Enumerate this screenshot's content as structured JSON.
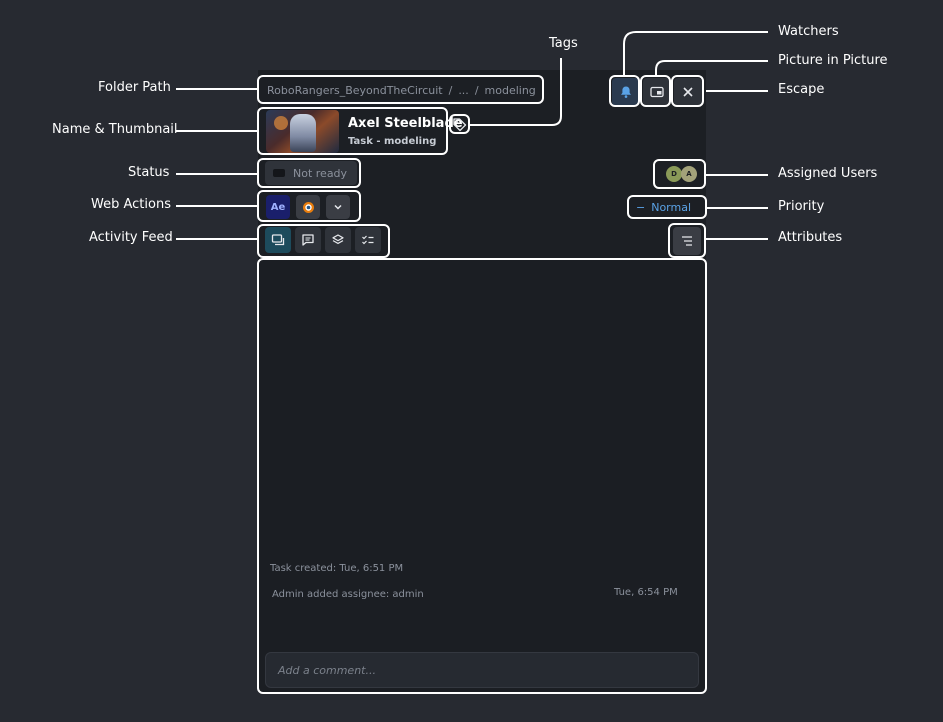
{
  "annotations": {
    "folder_path": "Folder Path",
    "name_thumbnail": "Name & Thumbnail",
    "status": "Status",
    "web_actions": "Web Actions",
    "activity_feed": "Activity Feed",
    "tags": "Tags",
    "watchers": "Watchers",
    "picture_in_picture": "Picture in Picture",
    "escape": "Escape",
    "assigned_users": "Assigned Users",
    "priority": "Priority",
    "attributes": "Attributes"
  },
  "breadcrumb": {
    "project": "RoboRangers_BeyondTheCircuit",
    "sep1": "/",
    "ellipsis": "...",
    "sep2": "/",
    "folder": "modeling"
  },
  "entity": {
    "name": "Axel Steelblade",
    "subtitle": "Task - modeling"
  },
  "status": {
    "label": "Not ready"
  },
  "assignees": [
    {
      "initial": "D",
      "color": "#8a9a58"
    },
    {
      "initial": "A",
      "color": "#a3a27a"
    }
  ],
  "web_actions": [
    {
      "label": "Ae",
      "icon": "after-effects-icon"
    },
    {
      "label": "",
      "icon": "blender-icon"
    }
  ],
  "priority": {
    "icon": "−",
    "label": "Normal"
  },
  "feed": {
    "task_created": "Task created: Tue, 6:51 PM",
    "assignee_event": "Admin added assignee: admin",
    "assignee_time": "Tue, 6:54 PM"
  },
  "comment": {
    "placeholder": "Add a comment..."
  },
  "colors": {
    "background": "#272a31",
    "panel": "#1c1f24",
    "accent": "#5aa2e6",
    "watcher_active": "#5aa2e6"
  }
}
